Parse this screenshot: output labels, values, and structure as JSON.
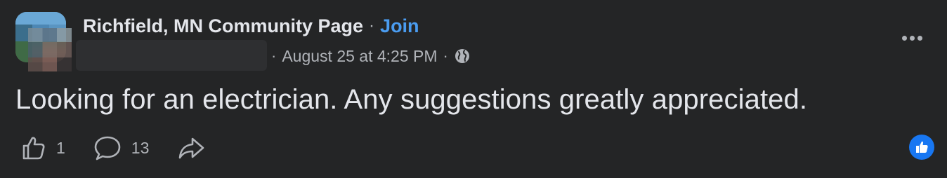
{
  "post": {
    "group_name": "Richfield, MN Community Page",
    "separator": "·",
    "join_label": "Join",
    "timestamp": "August 25 at 4:25 PM",
    "privacy_icon": "globe-icon",
    "more_icon": "more-options-icon",
    "text": "Looking for an electrician. Any suggestions greatly appreciated."
  },
  "actions": {
    "like_count": "1",
    "comment_count": "13",
    "like_icon": "thumbs-up-icon",
    "comment_icon": "comment-bubble-icon",
    "share_icon": "share-arrow-icon"
  },
  "reactions": {
    "badge_icon": "like-reaction-icon",
    "badge_color": "#1877f2"
  },
  "colors": {
    "background": "#242526",
    "primary_text": "#e4e6eb",
    "secondary_text": "#b0b3b8",
    "link": "#4a9cf0"
  }
}
